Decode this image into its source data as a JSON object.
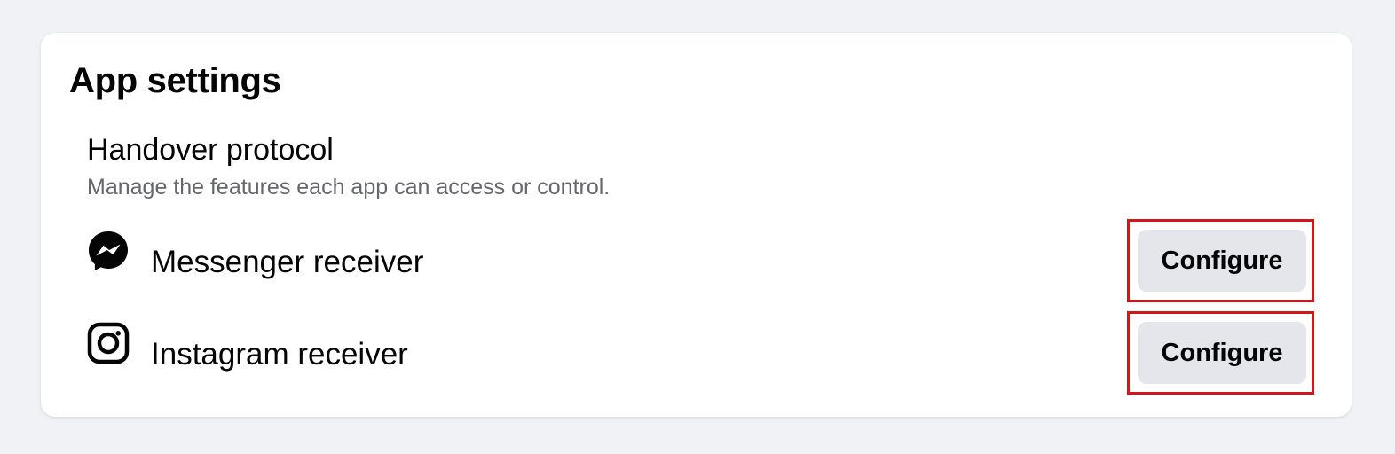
{
  "card": {
    "title": "App settings"
  },
  "handover": {
    "title": "Handover protocol",
    "description": "Manage the features each app can access or control."
  },
  "receivers": [
    {
      "icon": "messenger-icon",
      "label": "Messenger receiver",
      "button_label": "Configure"
    },
    {
      "icon": "instagram-icon",
      "label": "Instagram receiver",
      "button_label": "Configure"
    }
  ],
  "colors": {
    "background": "#f0f2f5",
    "card": "#ffffff",
    "button": "#e4e6eb",
    "secondary_text": "#65676b",
    "highlight_border": "#d0171d"
  }
}
